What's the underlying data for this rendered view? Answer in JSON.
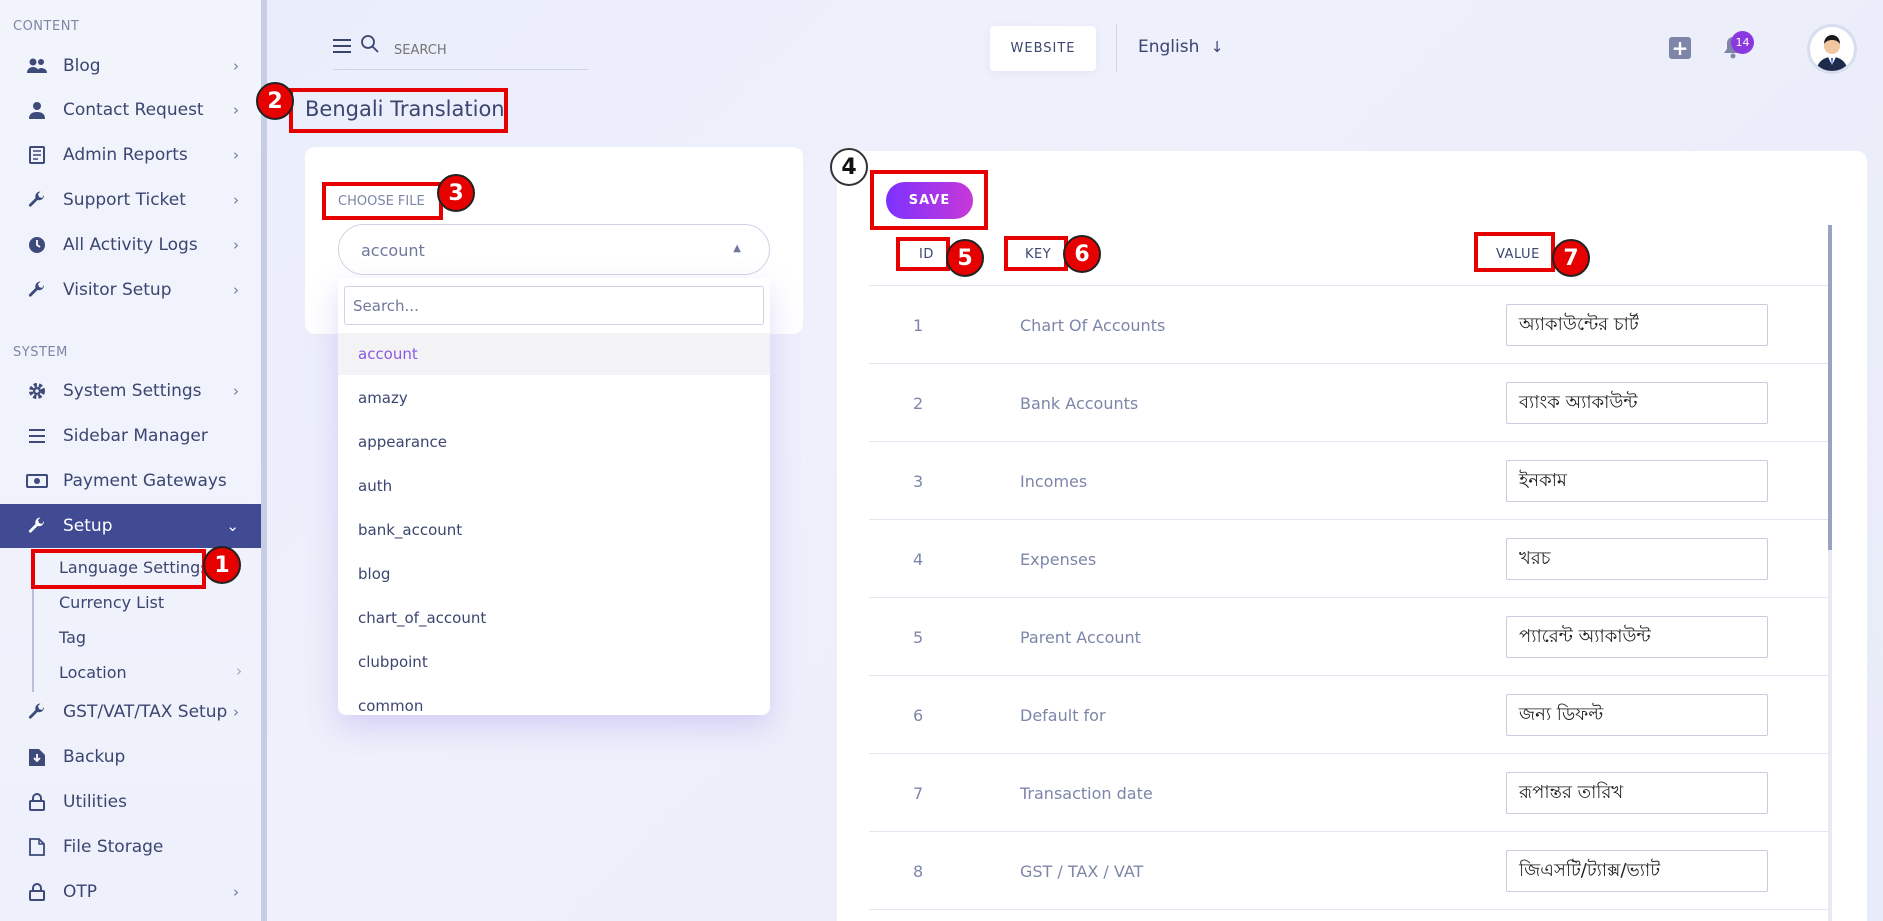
{
  "sidebar": {
    "content_label": "CONTENT",
    "system_label": "SYSTEM",
    "items": [
      {
        "label": "Blog",
        "icon": "users-icon"
      },
      {
        "label": "Contact Request",
        "icon": "user-icon"
      },
      {
        "label": "Admin Reports",
        "icon": "report-icon"
      },
      {
        "label": "Support Ticket",
        "icon": "wrench-icon"
      },
      {
        "label": "All Activity Logs",
        "icon": "clock-icon"
      },
      {
        "label": "Visitor Setup",
        "icon": "wrench-icon"
      },
      {
        "label": "System Settings",
        "icon": "gear-icon"
      },
      {
        "label": "Sidebar Manager",
        "icon": "menu-icon"
      },
      {
        "label": "Payment Gateways",
        "icon": "money-icon"
      },
      {
        "label": "Setup",
        "icon": "wrench-icon"
      },
      {
        "label": "GST/VAT/TAX Setup",
        "icon": "wrench-icon"
      },
      {
        "label": "Backup",
        "icon": "download-icon"
      },
      {
        "label": "Utilities",
        "icon": "lock-icon"
      },
      {
        "label": "File Storage",
        "icon": "file-icon"
      },
      {
        "label": "OTP",
        "icon": "lock-icon"
      }
    ],
    "setup_sub": [
      "Language Settings",
      "Currency List",
      "Tag",
      "Location"
    ]
  },
  "topbar": {
    "search_placeholder": "SEARCH",
    "website_label": "WEBSITE",
    "language": "English",
    "notification_count": "14"
  },
  "page": {
    "title": "Bengali Translation",
    "choose_file_label": "CHOOSE FILE",
    "selected_file": "account",
    "dropdown_search_placeholder": "Search...",
    "dropdown_options": [
      "account",
      "amazy",
      "appearance",
      "auth",
      "bank_account",
      "blog",
      "chart_of_account",
      "clubpoint",
      "common"
    ]
  },
  "table": {
    "save_label": "SAVE",
    "headers": {
      "id": "ID",
      "key": "KEY",
      "value": "VALUE"
    },
    "rows": [
      {
        "id": "1",
        "key": "Chart Of Accounts",
        "value": "অ্যাকাউন্টের চার্ট"
      },
      {
        "id": "2",
        "key": "Bank Accounts",
        "value": "ব্যাংক অ্যাকাউন্ট"
      },
      {
        "id": "3",
        "key": "Incomes",
        "value": "ইনকাম"
      },
      {
        "id": "4",
        "key": "Expenses",
        "value": "খরচ"
      },
      {
        "id": "5",
        "key": "Parent Account",
        "value": "প্যারেন্ট অ্যাকাউন্ট"
      },
      {
        "id": "6",
        "key": "Default for",
        "value": "জন্য ডিফল্ট"
      },
      {
        "id": "7",
        "key": "Transaction date",
        "value": "রূপান্তর তারিখ"
      },
      {
        "id": "8",
        "key": "GST / TAX / VAT",
        "value": "জিএসটি/ট্যাক্স/ভ্যাট"
      }
    ]
  },
  "annotations": [
    "1",
    "2",
    "3",
    "4",
    "5",
    "6",
    "7"
  ],
  "colors": {
    "accent": "#404b93",
    "save_gradient_start": "#7c32ff",
    "save_gradient_end": "#c738d8",
    "annotation": "#e60000"
  }
}
